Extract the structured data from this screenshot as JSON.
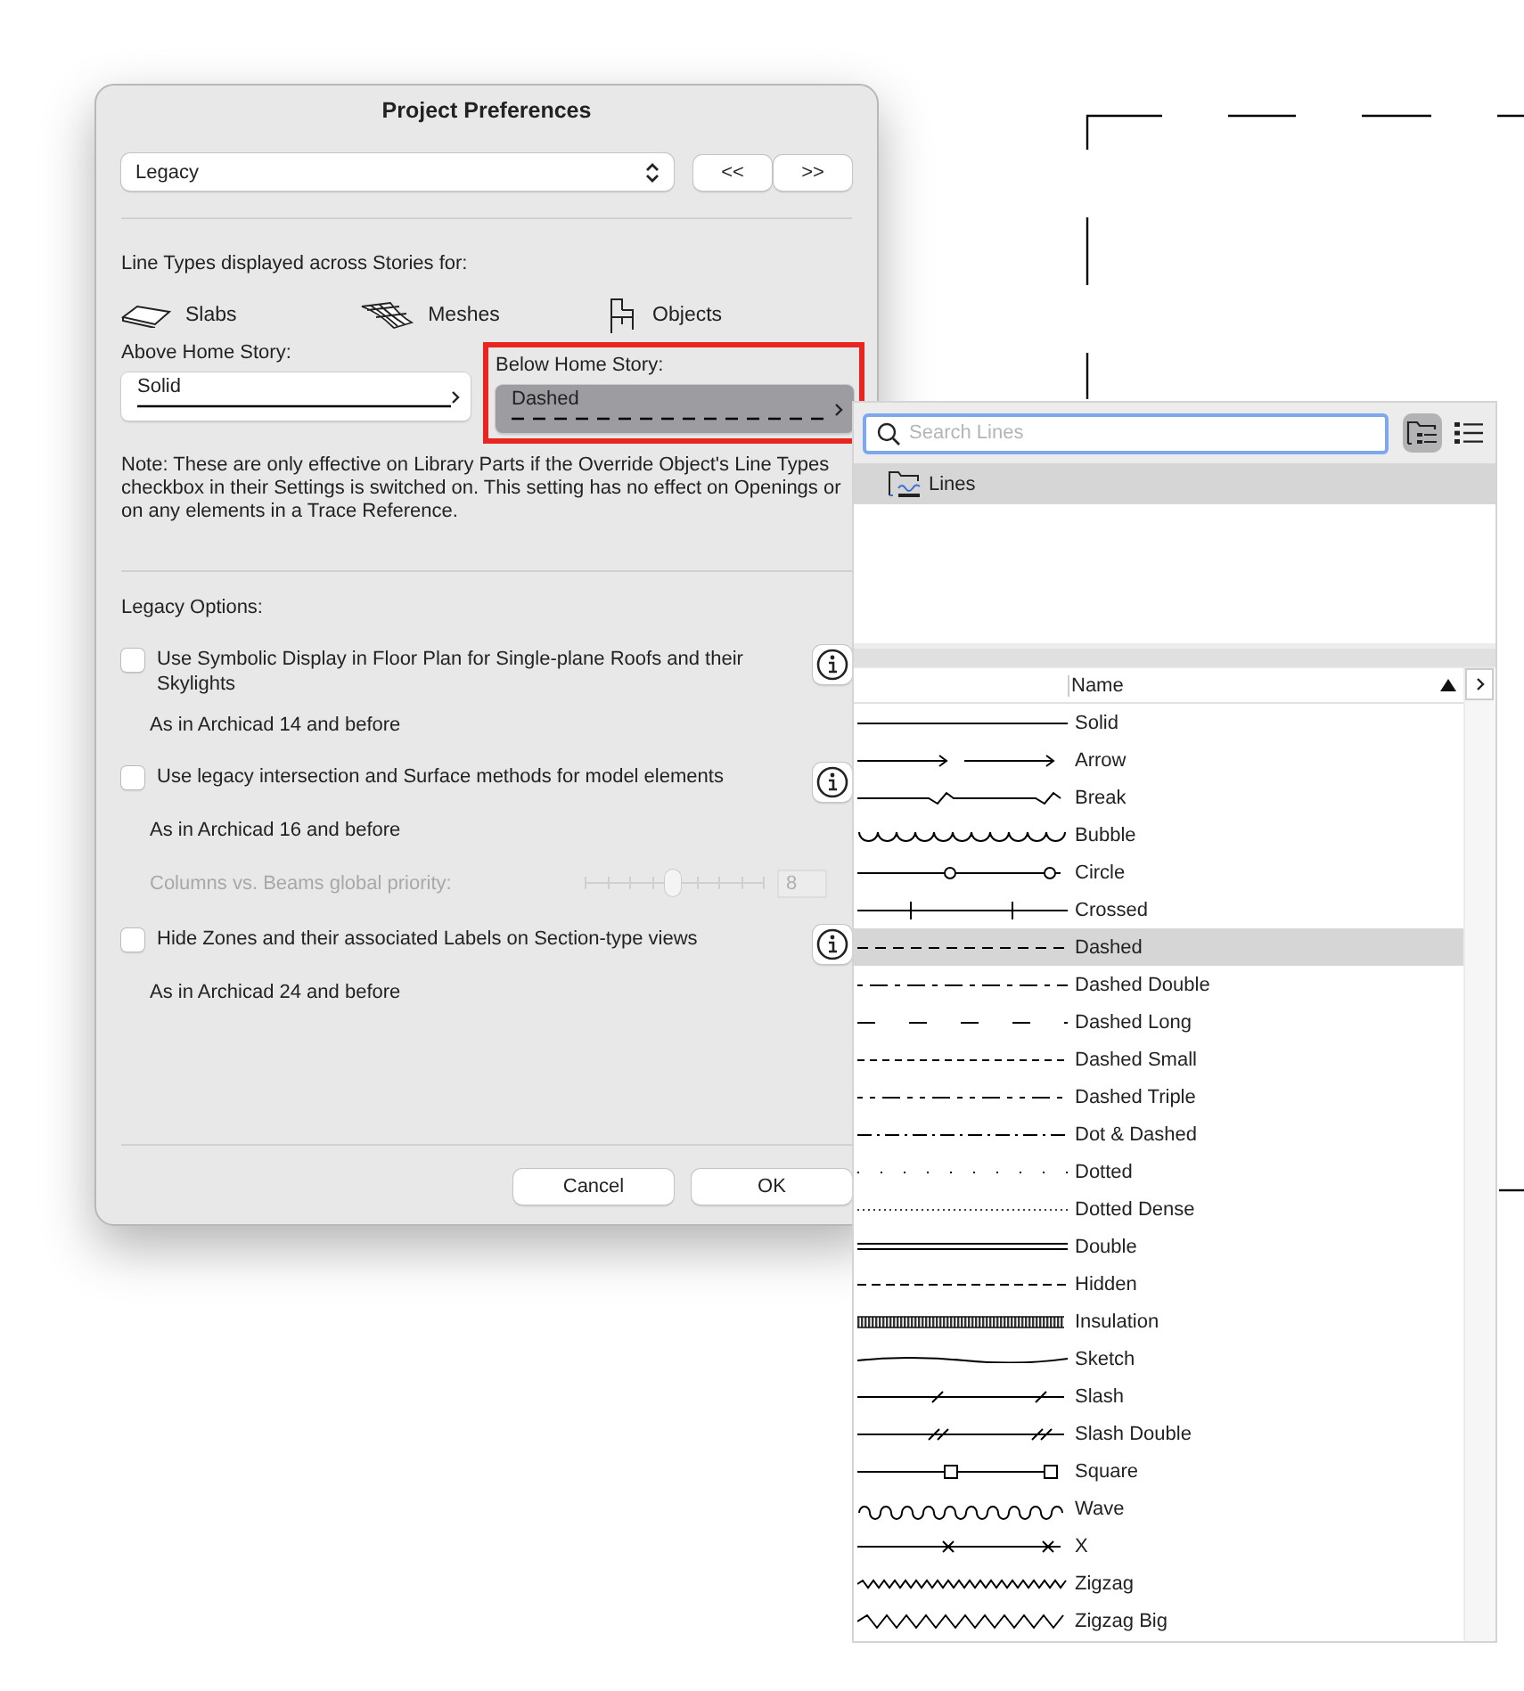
{
  "dialog": {
    "title": "Project Preferences",
    "page_select": "Legacy",
    "prev_button": "<<",
    "next_button": ">>",
    "line_types_heading": "Line Types displayed across Stories for:",
    "element_types": [
      {
        "kind": "slab",
        "label": "Slabs"
      },
      {
        "kind": "mesh",
        "label": "Meshes"
      },
      {
        "kind": "object",
        "label": "Objects"
      }
    ],
    "stories": [
      {
        "label": "Above Home Story:",
        "value": "Solid",
        "kind": "solid",
        "active": false
      },
      {
        "label": "Below Home Story:",
        "value": "Dashed",
        "kind": "dashed",
        "active": true
      }
    ],
    "note": "Note: These are only effective on Library Parts if the Override Object's Line Types checkbox in their Settings is switched on. This setting has no effect on Openings or on any elements in a Trace Reference.",
    "legacy_heading": "Legacy Options:",
    "options": [
      {
        "label": "Use Symbolic Display in Floor Plan for Single-plane Roofs and their Skylights",
        "checked": false,
        "note": "As in Archicad 14 and before"
      },
      {
        "label": "Use legacy intersection and Surface methods for model elements",
        "checked": false,
        "note": "As in Archicad 16 and before",
        "priority": {
          "label": "Columns vs. Beams global priority:",
          "level": 0.5,
          "value": "8",
          "disabled": true
        }
      },
      {
        "label": "Hide Zones and their associated Labels on Section-type views",
        "checked": false,
        "note": "As in Archicad 24 and before"
      }
    ],
    "buttons": [
      "Cancel",
      "OK"
    ]
  },
  "line_picker": {
    "search": {
      "placeholder": "Search Lines"
    },
    "view_buttons": [
      {
        "kind": "tree",
        "selected": true
      },
      {
        "kind": "list",
        "selected": false
      }
    ],
    "folders": [
      {
        "label": "Lines",
        "selected": true
      }
    ],
    "column": "Name",
    "rows": [
      {
        "name": "Solid",
        "kind": "solid",
        "selected": false
      },
      {
        "name": "Arrow",
        "kind": "arrow",
        "selected": false
      },
      {
        "name": "Break",
        "kind": "break",
        "selected": false
      },
      {
        "name": "Bubble",
        "kind": "bubble",
        "selected": false
      },
      {
        "name": "Circle",
        "kind": "circle",
        "selected": false
      },
      {
        "name": "Crossed",
        "kind": "crossed",
        "selected": false
      },
      {
        "name": "Dashed",
        "kind": "dashed",
        "selected": true
      },
      {
        "name": "Dashed Double",
        "kind": "dashed_double",
        "selected": false
      },
      {
        "name": "Dashed Long",
        "kind": "dashed_long",
        "selected": false
      },
      {
        "name": "Dashed Small",
        "kind": "dashed_small",
        "selected": false
      },
      {
        "name": "Dashed Triple",
        "kind": "dashed_triple",
        "selected": false
      },
      {
        "name": "Dot & Dashed",
        "kind": "dot_dashed",
        "selected": false
      },
      {
        "name": "Dotted",
        "kind": "dotted",
        "selected": false
      },
      {
        "name": "Dotted Dense",
        "kind": "dotted_dense",
        "selected": false
      },
      {
        "name": "Double",
        "kind": "double",
        "selected": false
      },
      {
        "name": "Hidden",
        "kind": "hidden",
        "selected": false
      },
      {
        "name": "Insulation",
        "kind": "insulation",
        "selected": false
      },
      {
        "name": "Sketch",
        "kind": "sketch",
        "selected": false
      },
      {
        "name": "Slash",
        "kind": "slash",
        "selected": false
      },
      {
        "name": "Slash Double",
        "kind": "slash_double",
        "selected": false
      },
      {
        "name": "Square",
        "kind": "square",
        "selected": false
      },
      {
        "name": "Wave",
        "kind": "wave",
        "selected": false
      },
      {
        "name": "X",
        "kind": "x",
        "selected": false
      },
      {
        "name": "Zigzag",
        "kind": "zigzag",
        "selected": false
      },
      {
        "name": "Zigzag Big",
        "kind": "zigzag_big",
        "selected": false
      }
    ]
  }
}
